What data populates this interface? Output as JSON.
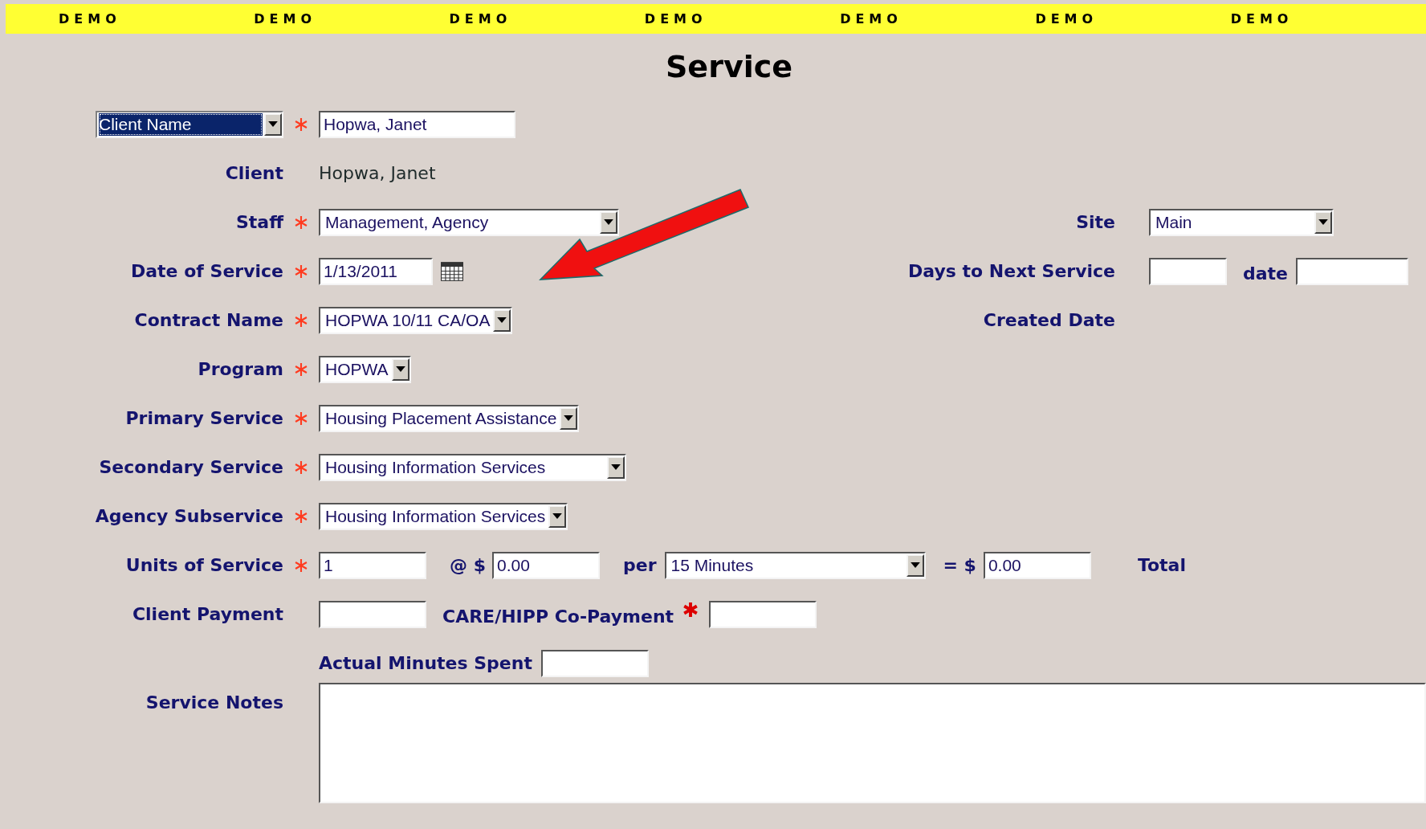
{
  "banner": [
    "DEMO",
    "DEMO",
    "DEMO",
    "DEMO",
    "DEMO",
    "DEMO",
    "DEMO"
  ],
  "title": "Service",
  "lookup": {
    "dropdown": {
      "value": "Client Name",
      "highlighted": true
    },
    "required": true,
    "field": {
      "value": "Hopwa, Janet"
    }
  },
  "rows": [
    {
      "label": "Client",
      "kind": "text",
      "required": false,
      "value": "Hopwa, Janet"
    },
    {
      "label": "Staff",
      "kind": "dropdown",
      "required": true,
      "value": "Management, Agency",
      "right": {
        "label": "Site",
        "kind": "dropdown",
        "value": "Main"
      }
    },
    {
      "label": "Date of Service",
      "kind": "date",
      "required": true,
      "value": "1/13/2011",
      "right": {
        "label": "Days to Next Service",
        "kind": "days",
        "date_label": "date"
      }
    },
    {
      "label": "Contract Name",
      "kind": "dropdown",
      "required": true,
      "value": "HOPWA 10/11 CA/OA",
      "right": {
        "label": "Created Date",
        "kind": "label"
      }
    },
    {
      "label": "Program",
      "kind": "dropdown",
      "required": true,
      "value": "HOPWA"
    },
    {
      "label": "Primary Service",
      "kind": "dropdown",
      "required": true,
      "value": "Housing Placement Assistance"
    },
    {
      "label": "Secondary Service",
      "kind": "dropdown",
      "required": true,
      "value": "Housing Information Services"
    },
    {
      "label": "Agency Subservice",
      "kind": "dropdown",
      "required": true,
      "value": "Housing Information Services"
    },
    {
      "label": "Units of Service",
      "kind": "units",
      "required": true,
      "value": "1",
      "at": "@ $",
      "rate": "0.00",
      "per": "per",
      "period": "15 Minutes",
      "equals": "= $",
      "total": "0.00",
      "total_label": "Total"
    },
    {
      "label": "Client Payment",
      "kind": "payment",
      "required": false,
      "copay_label": "CARE/HIPP Co-Payment",
      "copay_required": true
    },
    {
      "label": "Actual Minutes Spent",
      "kind": "minutes",
      "required": false
    },
    {
      "label": "Service Notes",
      "kind": "notes",
      "required": false
    }
  ]
}
